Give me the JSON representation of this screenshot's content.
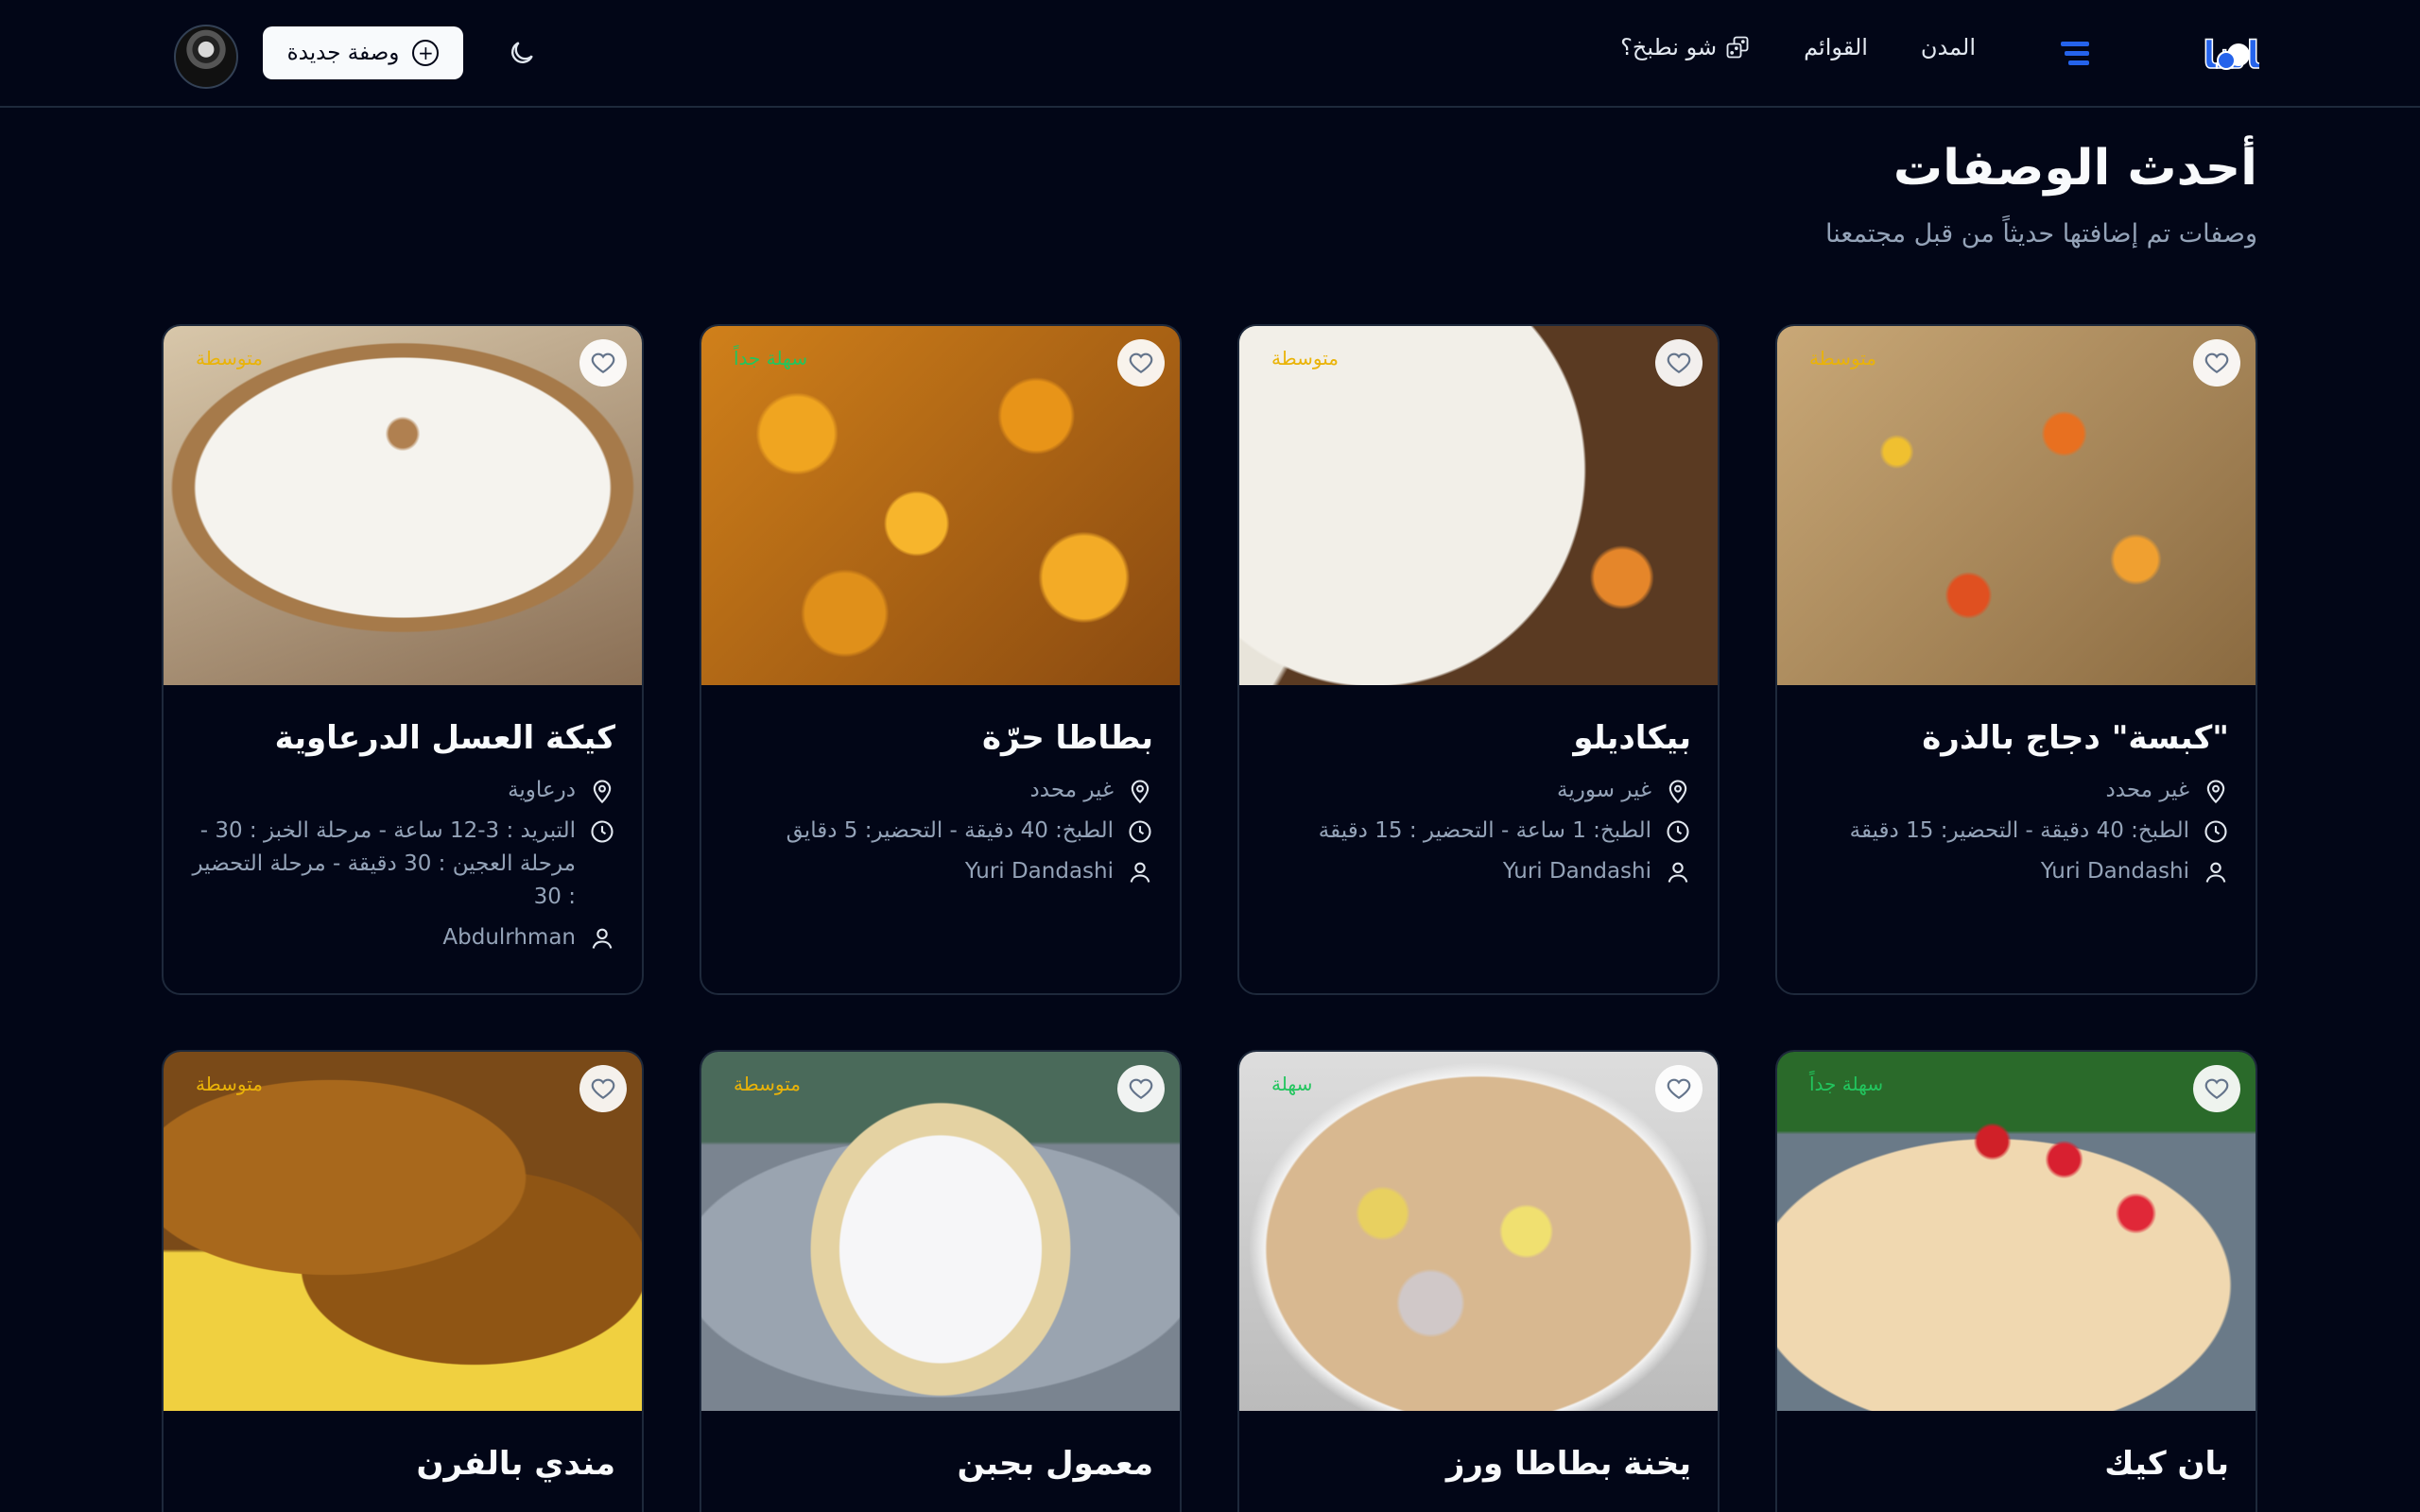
{
  "nav": {
    "logo_text": "وصفاتنا",
    "links": [
      {
        "label": "المدن"
      },
      {
        "label": "القوائم"
      },
      {
        "label": "شو نطبخ؟"
      }
    ],
    "new_recipe_label": "وصفة جديدة"
  },
  "page": {
    "title": "أحدث الوصفات",
    "subtitle": "وصفات تم إضافتها حديثاً من قبل مجتمعنا"
  },
  "colors": {
    "background": "#020617",
    "medium": "#eab308",
    "easy": "#22c55e",
    "muted": "#94a3b8"
  },
  "recipes": [
    {
      "title": "\"كبسة\" دجاج بالذرة",
      "difficulty": "متوسطة",
      "location": "غير محدد",
      "time": "الطبخ: 40 دقيقة - التحضير: 15 دقيقة",
      "author": "Yuri Dandashi"
    },
    {
      "title": "بيكاديلو",
      "difficulty": "متوسطة",
      "location": "غير سورية",
      "time": "الطبخ: 1 ساعة - التحضير : 15 دقيقة",
      "author": "Yuri Dandashi"
    },
    {
      "title": "بطاطا حرّة",
      "difficulty": "سهلة جداً",
      "location": "غير محدد",
      "time": "الطبخ: 40 دقيقة - التحضير: 5 دقايق",
      "author": "Yuri Dandashi"
    },
    {
      "title": "كيكة العسل الدرعاوية",
      "difficulty": "متوسطة",
      "location": "درعاوية",
      "time": "التبريد : 3-12 ساعة - مرحلة الخبز : 30 - مرحلة العجين : 30 دقيقة - مرحلة التحضير : 30",
      "author": "Abdulrhman"
    },
    {
      "title": "بان كيك",
      "difficulty": "سهلة جداً"
    },
    {
      "title": "يخنة بطاطا ورز",
      "difficulty": "سهلة"
    },
    {
      "title": "معمول بجبن",
      "difficulty": "متوسطة"
    },
    {
      "title": "مندي بالفرن",
      "difficulty": "متوسطة"
    }
  ]
}
